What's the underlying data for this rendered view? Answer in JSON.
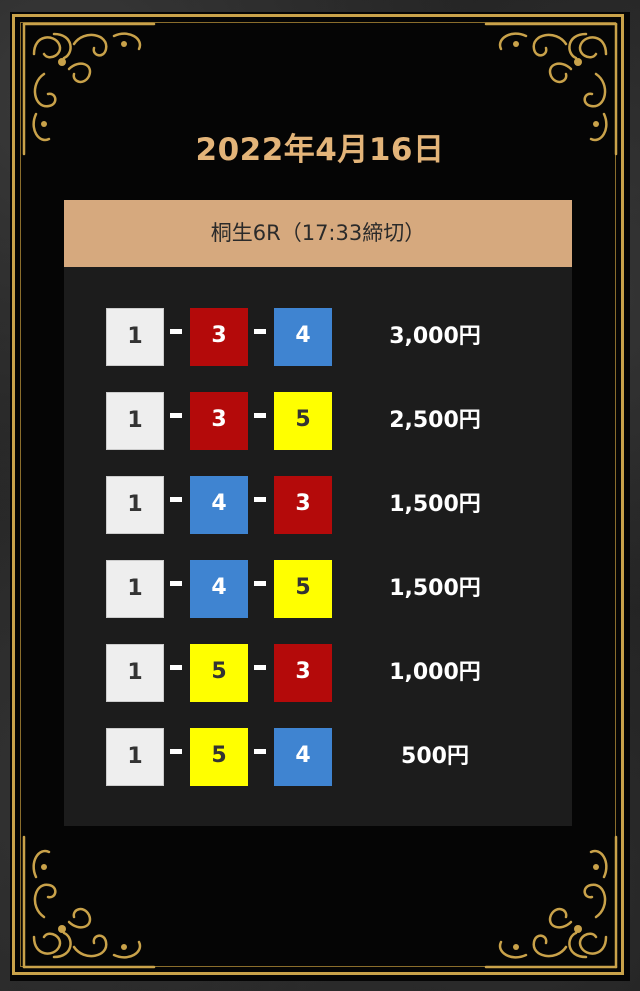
{
  "date": "2022年4月16日",
  "race": {
    "header": "桐生6R（17:33締切）"
  },
  "colors": {
    "gold": "#c9a24a",
    "title": "#e3b479",
    "header_bg": "#d6a97e",
    "panel_bg": "#1c1c1c",
    "boat_1": "#eeeeee",
    "boat_3": "#b40a0a",
    "boat_4": "#3f84d1",
    "boat_5": "#ffff00"
  },
  "bets": [
    {
      "first": "1",
      "second": "3",
      "third": "4",
      "amount": "3,000円"
    },
    {
      "first": "1",
      "second": "3",
      "third": "5",
      "amount": "2,500円"
    },
    {
      "first": "1",
      "second": "4",
      "third": "3",
      "amount": "1,500円"
    },
    {
      "first": "1",
      "second": "4",
      "third": "5",
      "amount": "1,500円"
    },
    {
      "first": "1",
      "second": "5",
      "third": "3",
      "amount": "1,000円"
    },
    {
      "first": "1",
      "second": "5",
      "third": "4",
      "amount": "500円"
    }
  ]
}
